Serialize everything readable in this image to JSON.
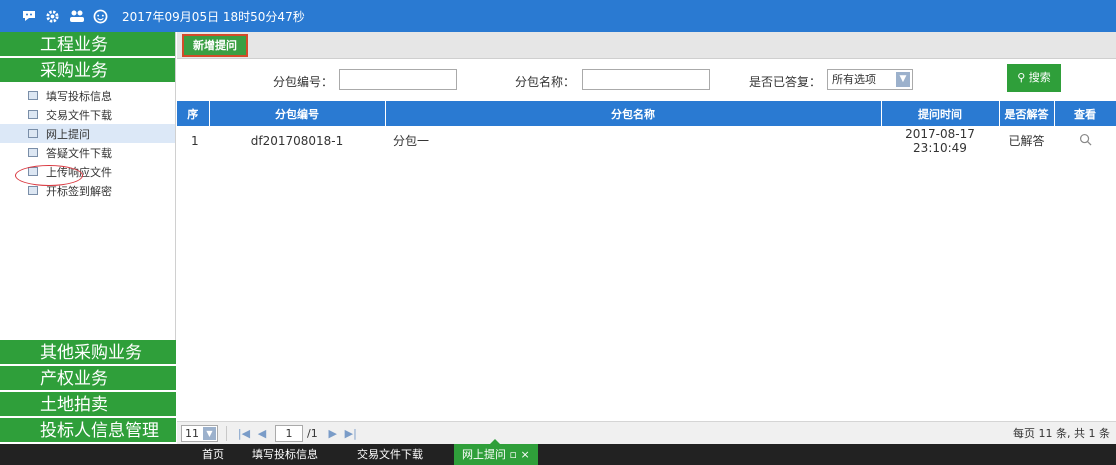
{
  "topbar": {
    "icons": [
      "chat-icon",
      "gear-icon",
      "users-icon",
      "help-icon"
    ],
    "datetime": "2017年09月05日 18时50分47秒"
  },
  "sidebar": {
    "groups_top": [
      "工程业务",
      "采购业务"
    ],
    "items": [
      {
        "label": "填写投标信息"
      },
      {
        "label": "交易文件下载"
      },
      {
        "label": "网上提问"
      },
      {
        "label": "答疑文件下载"
      },
      {
        "label": "上传响应文件"
      },
      {
        "label": "开标签到解密"
      }
    ],
    "groups_bottom": [
      "其他采购业务",
      "产权业务",
      "土地拍卖",
      "投标人信息管理"
    ]
  },
  "toolbar": {
    "new_label": "新增提问"
  },
  "filter": {
    "code_label": "分包编号：",
    "name_label": "分包名称：",
    "answered_label": "是否已答复：",
    "answered_value": "所有选项",
    "search_label": "搜索"
  },
  "table": {
    "headers": [
      "序",
      "分包编号",
      "分包名称",
      "提问时间",
      "是否解答",
      "查看"
    ],
    "rows": [
      {
        "idx": "1",
        "code": "df201708018-1",
        "name": "分包一",
        "time": "2017-08-17 23:10:49",
        "answered": "已解答"
      }
    ]
  },
  "pager": {
    "page_size": "11",
    "page": "1",
    "total_pages": "/1",
    "info": "每页 11 条, 共 1 条"
  },
  "footer": {
    "tabs": [
      "首页",
      "填写投标信息",
      "交易文件下载",
      "网上提问 ▫ ×"
    ]
  },
  "colors": {
    "accent_blue": "#2a7ad2",
    "accent_green": "#2f9f3a",
    "highlight_red": "#d9363e"
  }
}
